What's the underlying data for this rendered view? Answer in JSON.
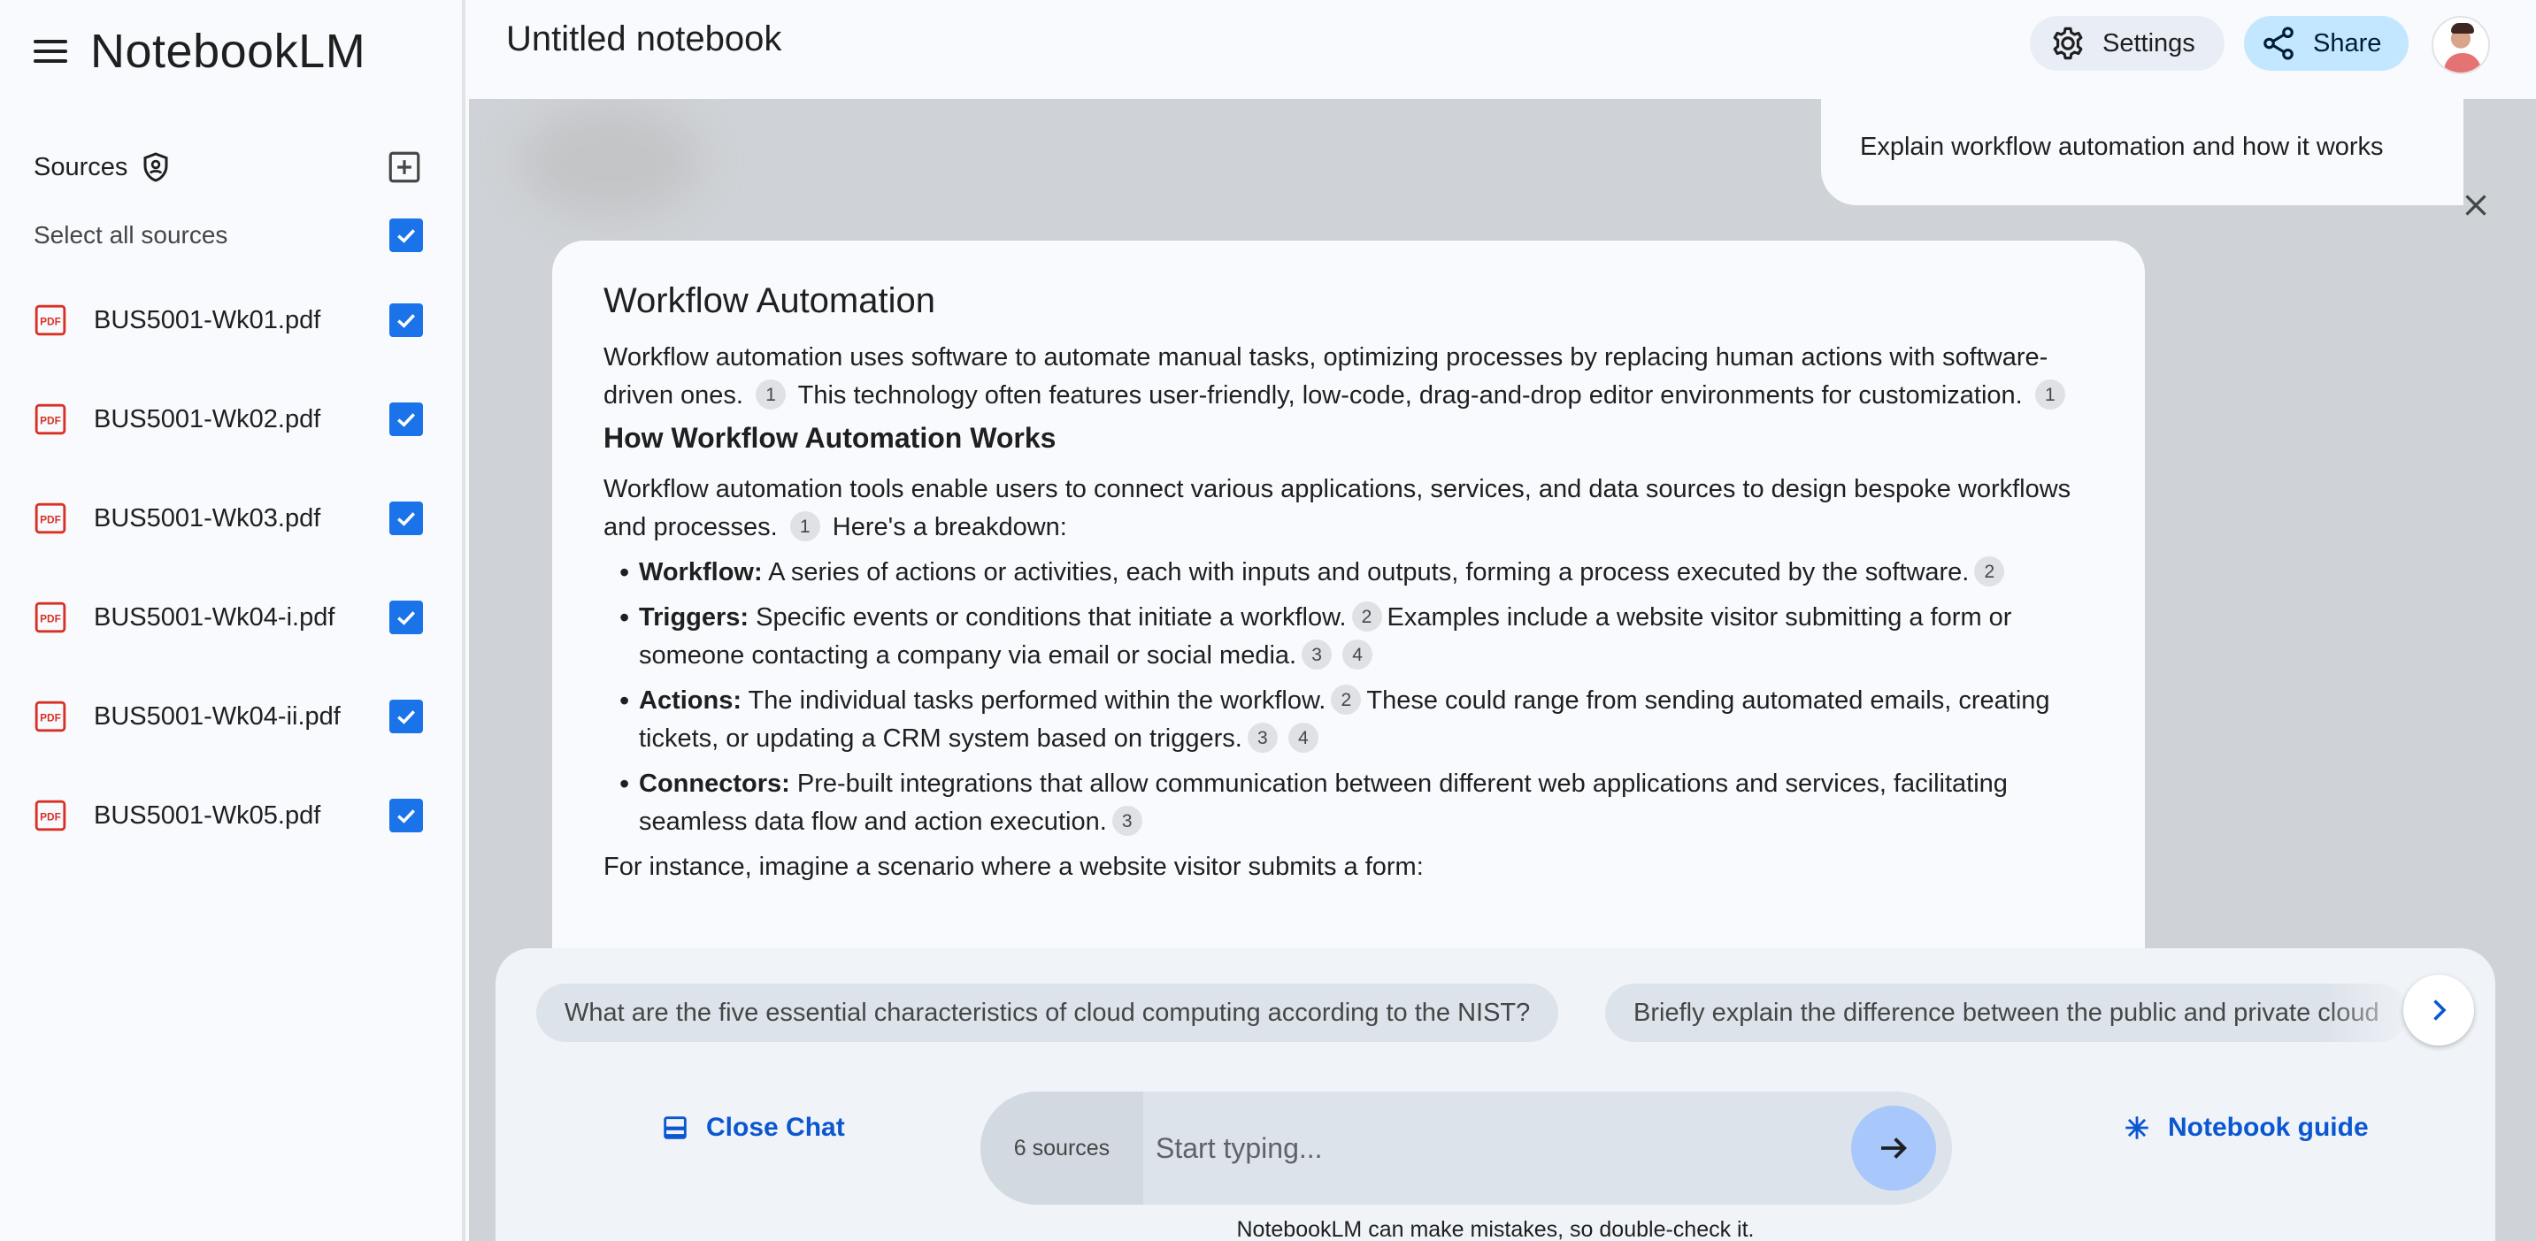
{
  "app": {
    "name": "NotebookLM"
  },
  "notebook": {
    "title": "Untitled notebook"
  },
  "header": {
    "settings_label": "Settings",
    "share_label": "Share"
  },
  "sidebar": {
    "sources_title": "Sources",
    "select_all_label": "Select all sources",
    "select_all_checked": true,
    "sources": [
      {
        "name": "BUS5001-Wk01.pdf",
        "checked": true,
        "icon": "pdf-icon"
      },
      {
        "name": "BUS5001-Wk02.pdf",
        "checked": true,
        "icon": "pdf-icon"
      },
      {
        "name": "BUS5001-Wk03.pdf",
        "checked": true,
        "icon": "pdf-icon"
      },
      {
        "name": "BUS5001-Wk04-i.pdf",
        "checked": true,
        "icon": "pdf-icon"
      },
      {
        "name": "BUS5001-Wk04-ii.pdf",
        "checked": true,
        "icon": "pdf-icon"
      },
      {
        "name": "BUS5001-Wk05.pdf",
        "checked": true,
        "icon": "pdf-icon"
      }
    ]
  },
  "chat": {
    "user_message": "Explain workflow automation and how it works",
    "response": {
      "title": "Workflow Automation",
      "intro_a": "Workflow automation uses software to automate manual tasks, optimizing processes by replacing human actions with software-driven ones.",
      "intro_cite_a": "1",
      "intro_b": "This technology often features user-friendly, low-code, drag-and-drop editor environments for customization.",
      "intro_cite_b": "1",
      "subtitle": "How Workflow Automation Works",
      "p2_a": "Workflow automation tools enable users to connect various applications, services, and data sources to design bespoke workflows and processes.",
      "p2_cite": "1",
      "p2_b": "Here's a breakdown:",
      "bullets": [
        {
          "term": "Workflow:",
          "text_a": "A series of actions or activities, each with inputs and outputs, forming a process executed by the software.",
          "cite_a": "2"
        },
        {
          "term": "Triggers:",
          "text_a": "Specific events or conditions that initiate a workflow.",
          "cite_a": "2",
          "text_b": "Examples include a website visitor submitting a form or someone contacting a company via email or social media.",
          "cite_b1": "3",
          "cite_b2": "4"
        },
        {
          "term": "Actions:",
          "text_a": "The individual tasks performed within the workflow.",
          "cite_a": "2",
          "text_b": "These could range from sending automated emails, creating tickets, or updating a CRM system based on triggers.",
          "cite_b1": "3",
          "cite_b2": "4"
        },
        {
          "term": "Connectors:",
          "text_a": "Pre-built integrations that allow communication between different web applications and services, facilitating seamless data flow and action execution.",
          "cite_a": "3"
        }
      ],
      "closing": "For instance, imagine a scenario where a website visitor submits a form:"
    },
    "suggestions": [
      "What are the five essential characteristics of cloud computing according to the NIST?",
      "Briefly explain the difference between the public and private cloud"
    ],
    "close_chat_label": "Close Chat",
    "sources_count": "6 sources",
    "input_placeholder": "Start typing...",
    "input_value": "",
    "notebook_guide_label": "Notebook guide",
    "disclaimer": "NotebookLM can make mistakes, so double-check it."
  },
  "colors": {
    "accent": "#0b57d0",
    "checkbox": "#1a73e8",
    "pdf_red": "#d93025",
    "share_bg": "#c2e7ff"
  }
}
